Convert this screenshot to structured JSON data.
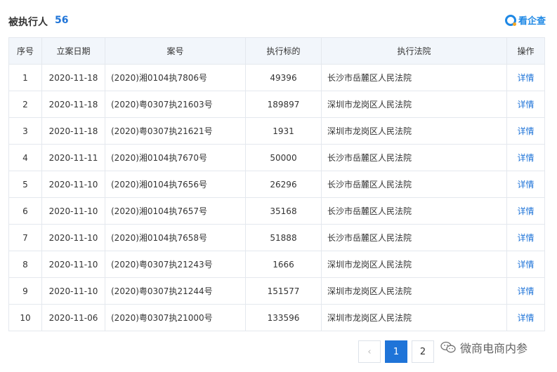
{
  "header": {
    "title": "被执行人",
    "count": "56",
    "brand": "看企查"
  },
  "table": {
    "columns": [
      "序号",
      "立案日期",
      "案号",
      "执行标的",
      "执行法院",
      "操作"
    ],
    "rows": [
      [
        "1",
        "2020-11-18",
        "(2020)湘0104执7806号",
        "49396",
        "长沙市岳麓区人民法院",
        "详情"
      ],
      [
        "2",
        "2020-11-18",
        "(2020)粤0307执21603号",
        "189897",
        "深圳市龙岗区人民法院",
        "详情"
      ],
      [
        "3",
        "2020-11-18",
        "(2020)粤0307执21621号",
        "1931",
        "深圳市龙岗区人民法院",
        "详情"
      ],
      [
        "4",
        "2020-11-11",
        "(2020)湘0104执7670号",
        "50000",
        "长沙市岳麓区人民法院",
        "详情"
      ],
      [
        "5",
        "2020-11-10",
        "(2020)湘0104执7656号",
        "26296",
        "长沙市岳麓区人民法院",
        "详情"
      ],
      [
        "6",
        "2020-11-10",
        "(2020)湘0104执7657号",
        "35168",
        "长沙市岳麓区人民法院",
        "详情"
      ],
      [
        "7",
        "2020-11-10",
        "(2020)湘0104执7658号",
        "51888",
        "长沙市岳麓区人民法院",
        "详情"
      ],
      [
        "8",
        "2020-11-10",
        "(2020)粤0307执21243号",
        "1666",
        "深圳市龙岗区人民法院",
        "详情"
      ],
      [
        "9",
        "2020-11-10",
        "(2020)粤0307执21244号",
        "151577",
        "深圳市龙岗区人民法院",
        "详情"
      ],
      [
        "10",
        "2020-11-06",
        "(2020)粤0307执21000号",
        "133596",
        "深圳市龙岗区人民法院",
        "详情"
      ]
    ]
  },
  "pagination": {
    "prev": "‹",
    "pages": [
      "1",
      "2"
    ],
    "current": "1"
  },
  "watermark": {
    "text": "微商电商内参"
  },
  "colors": {
    "accent": "#1f74d8",
    "header_bg": "#f2f6fb",
    "border": "#e4e8ee"
  }
}
